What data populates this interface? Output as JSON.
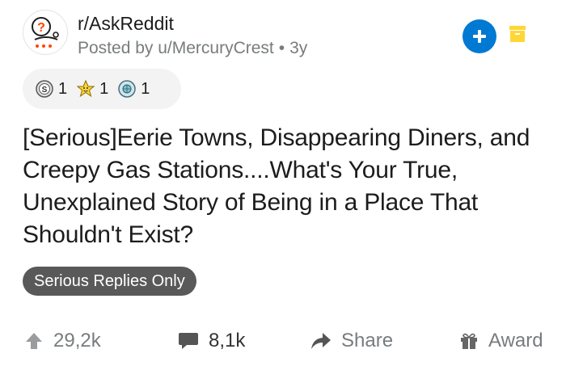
{
  "post": {
    "subreddit": "r/AskReddit",
    "posted_by": "Posted by u/MercuryCrest",
    "age": "3y",
    "title": "[Serious]Eerie Towns, Disappearing Diners, and Creepy Gas Stations....What's Your True, Unexplained Story of Being in a Place That Shouldn't Exist?",
    "flair": "Serious Replies Only"
  },
  "awards": [
    {
      "icon": "silver-award-icon",
      "count": "1"
    },
    {
      "icon": "wholesome-award-icon",
      "count": "1"
    },
    {
      "icon": "globe-award-icon",
      "count": "1"
    }
  ],
  "actions": {
    "upvotes": "29,2k",
    "comments": "8,1k",
    "share": "Share",
    "award": "Award"
  },
  "colors": {
    "accent": "#0079d3",
    "flair_bg": "#595959",
    "muted": "#787c7e",
    "notification": "#ffd635"
  }
}
